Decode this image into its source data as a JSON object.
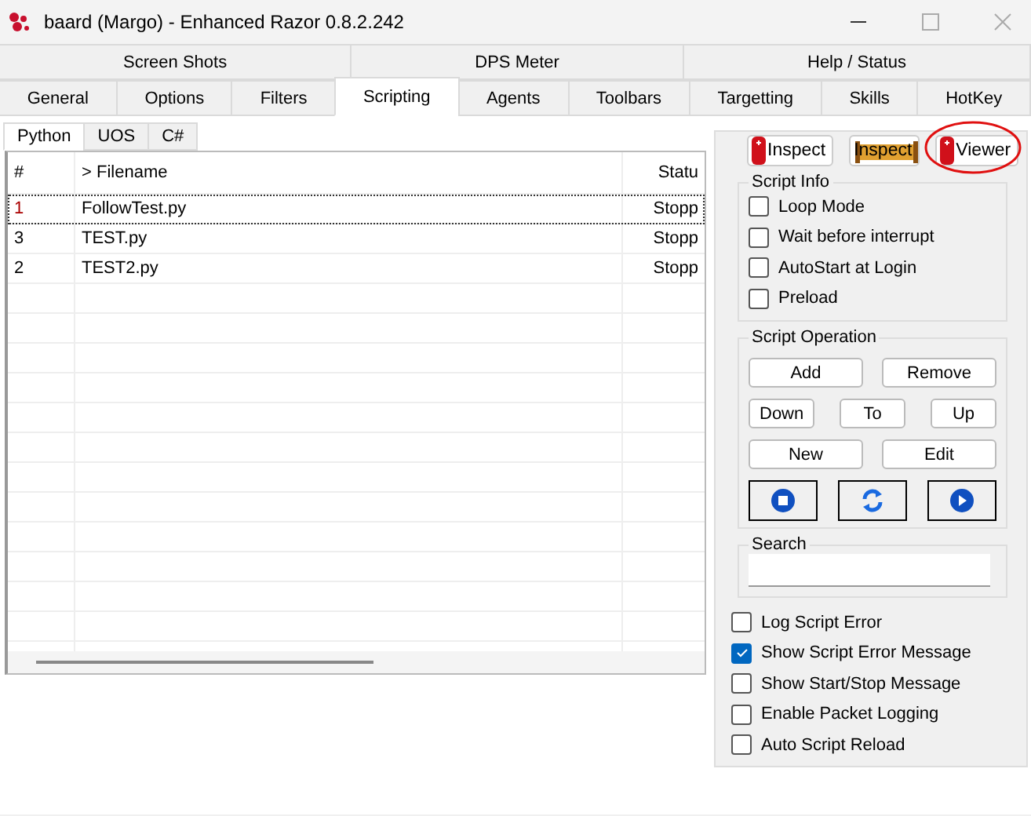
{
  "window": {
    "title": "baard (Margo) - Enhanced Razor 0.8.2.242"
  },
  "tab_rows": [
    [
      {
        "label": "Screen Shots",
        "selected": false
      },
      {
        "label": "DPS Meter",
        "selected": false
      },
      {
        "label": "Help / Status",
        "selected": false
      }
    ],
    [
      {
        "label": "General",
        "selected": false
      },
      {
        "label": "Options",
        "selected": false
      },
      {
        "label": "Filters",
        "selected": false
      },
      {
        "label": "Scripting",
        "selected": true
      },
      {
        "label": "Agents",
        "selected": false
      },
      {
        "label": "Toolbars",
        "selected": false
      },
      {
        "label": "Targetting",
        "selected": false
      },
      {
        "label": "Skills",
        "selected": false
      },
      {
        "label": "HotKey",
        "selected": false
      }
    ]
  ],
  "language_tabs": [
    {
      "label": "Python",
      "selected": true
    },
    {
      "label": "UOS",
      "selected": false
    },
    {
      "label": "C#",
      "selected": false
    }
  ],
  "table": {
    "columns": [
      "#",
      "> Filename",
      "Statu"
    ],
    "rows": [
      {
        "cells": [
          "1",
          "FollowTest.py",
          "Stopp"
        ],
        "focused": true
      },
      {
        "cells": [
          "3",
          "TEST.py",
          "Stopp"
        ],
        "focused": false
      },
      {
        "cells": [
          "2",
          "TEST2.py",
          "Stopp"
        ],
        "focused": false
      }
    ]
  },
  "tool_buttons": [
    {
      "label": "Inspect",
      "kind": "tag",
      "circled": false
    },
    {
      "label": "Inspect",
      "kind": "scroll",
      "circled": false
    },
    {
      "label": "Viewer",
      "kind": "tag",
      "circled": true
    }
  ],
  "script_info": {
    "title": "Script Info",
    "options": [
      {
        "label": "Loop Mode",
        "checked": false
      },
      {
        "label": "Wait before interrupt",
        "checked": false
      },
      {
        "label": "AutoStart at Login",
        "checked": false
      },
      {
        "label": "Preload",
        "checked": false
      }
    ]
  },
  "script_operation": {
    "title": "Script Operation",
    "rows": [
      [
        "Add",
        "Remove"
      ],
      [
        "Down",
        "To",
        "Up"
      ],
      [
        "New",
        "Edit"
      ]
    ],
    "media_buttons": [
      {
        "kind": "stop"
      },
      {
        "kind": "reload"
      },
      {
        "kind": "play"
      }
    ]
  },
  "search": {
    "title": "Search"
  },
  "options": [
    {
      "label": "Log Script Error",
      "checked": false
    },
    {
      "label": "Show Script Error Message",
      "checked": true
    },
    {
      "label": "Show Start/Stop Message",
      "checked": false
    },
    {
      "label": "Enable Packet Logging",
      "checked": false
    },
    {
      "label": "Auto Script Reload",
      "checked": false
    }
  ]
}
